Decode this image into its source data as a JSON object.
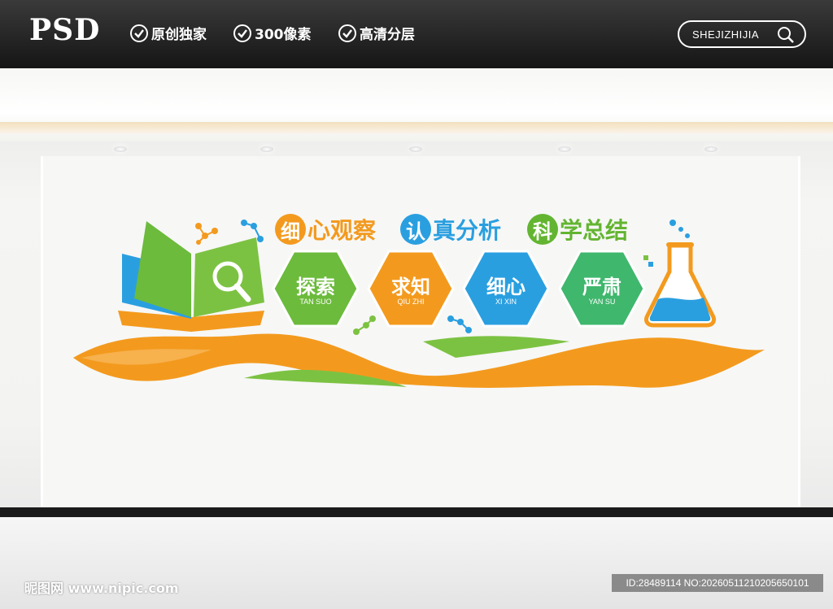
{
  "header": {
    "logo": "PSD",
    "features": [
      "原创独家",
      "300像素",
      "高清分层"
    ],
    "search_text": "SHEJIZHIJIA"
  },
  "wall": {
    "title_parts": [
      {
        "circle": "细",
        "rest": "心观察",
        "color": "#f39a1e"
      },
      {
        "circle": "认",
        "rest": "真分析",
        "color": "#2a9fe0"
      },
      {
        "circle": "科",
        "rest": "学总结",
        "color": "#63b531"
      }
    ],
    "hexagons": [
      {
        "main": "探索",
        "sub": "TAN SUO",
        "color": "#6cbb3c"
      },
      {
        "main": "求知",
        "sub": "QIU ZHI",
        "color": "#f39a1e"
      },
      {
        "main": "细心",
        "sub": "XI XIN",
        "color": "#2a9fe0"
      },
      {
        "main": "严肃",
        "sub": "YAN SU",
        "color": "#3fb76d"
      }
    ],
    "icons": [
      "book-magnifier-icon",
      "flask-icon",
      "molecule-icon",
      "wave-ribbon"
    ]
  },
  "watermark": {
    "site": "昵图网 www.nipic.com",
    "id": "ID:28489114 NO:20260511210205650101"
  }
}
